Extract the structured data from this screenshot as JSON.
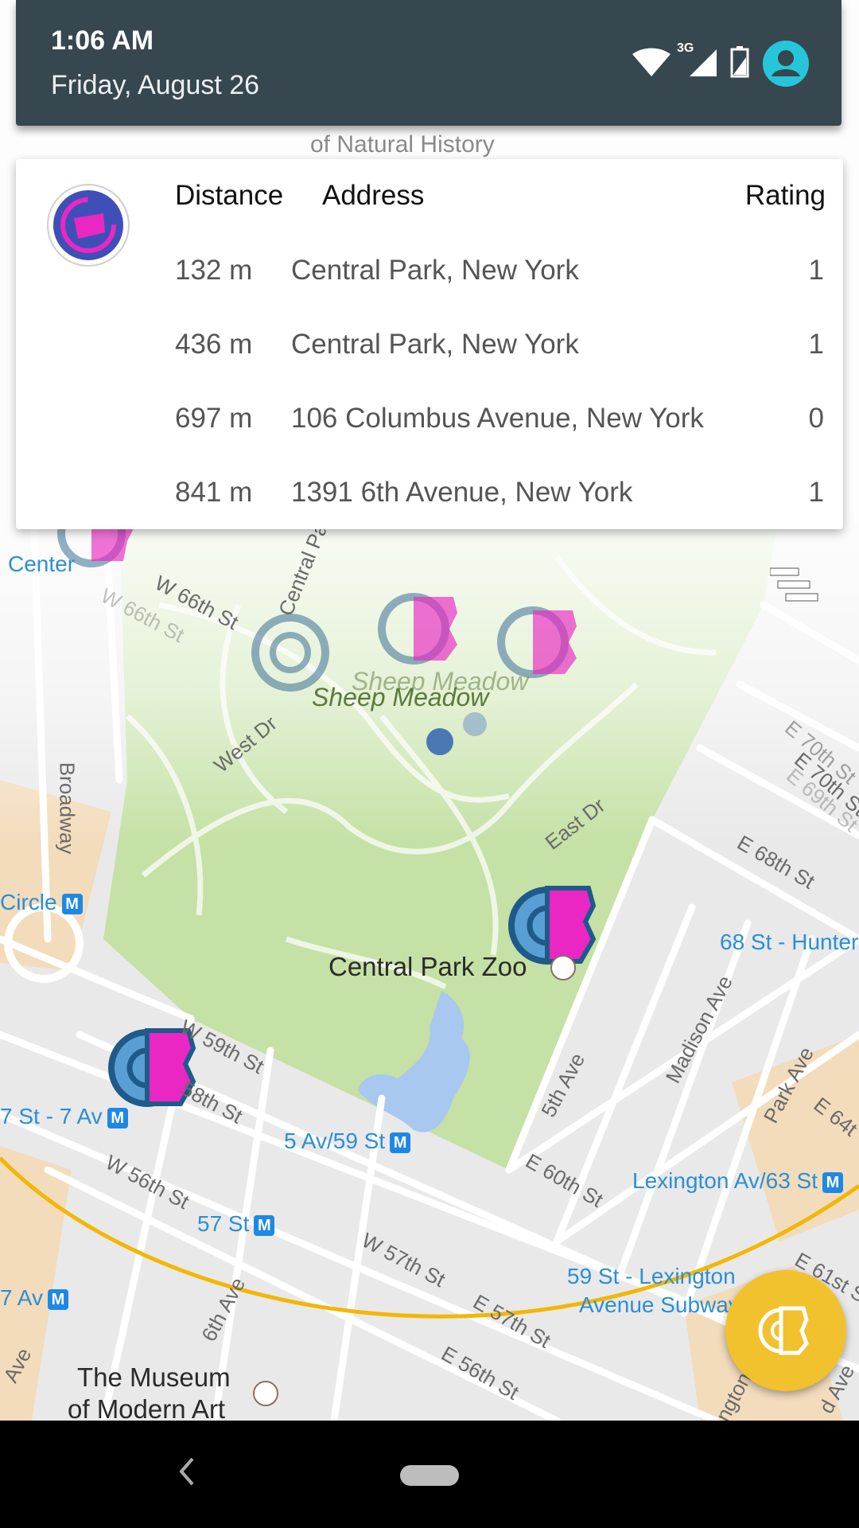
{
  "status_bar": {
    "time": "1:06 AM",
    "date": "Friday, August 26",
    "network_type": "3G",
    "icons": [
      "wifi-icon",
      "cell-signal-icon",
      "battery-icon",
      "account-icon"
    ],
    "account_color": "#26c6da"
  },
  "popup": {
    "icon": "team-gym-icon",
    "headers": {
      "distance": "Distance",
      "address": "Address",
      "rating": "Rating"
    },
    "rows": [
      {
        "distance": "132 m",
        "address": "Central Park, New York",
        "rating": "1"
      },
      {
        "distance": "436 m",
        "address": "Central Park, New York",
        "rating": "1"
      },
      {
        "distance": "697 m",
        "address": "106 Columbus Avenue, New York",
        "rating": "0"
      },
      {
        "distance": "841 m",
        "address": "1391 6th Avenue, New York",
        "rating": "1"
      }
    ]
  },
  "map": {
    "labels": {
      "sheep_meadow_1": "Sheep Meadow",
      "sheep_meadow_2": "Sheep Meadow",
      "central_park_zoo": "Central Park Zoo",
      "museum_line1": "The Museum",
      "museum_line2": "of Modern Art",
      "center": "Center",
      "circle": "Circle",
      "broadway": "Broadway",
      "w66": "W 66th St",
      "w66b": "W 66th St",
      "central_park_w": "Central Pa",
      "west_dr": "West Dr",
      "east_dr": "East Dr",
      "e70": "E 70th St",
      "e70b": "E 70th St",
      "e69": "E 69th St",
      "e68": "E 68th St",
      "st68": "68 St - Hunter",
      "w59": "W 59th St",
      "w58": "58th St",
      "st7": "7 St - 7 Av",
      "av59": "5 Av/59 St",
      "fifth_ave": "5th Ave",
      "madison": "Madison Ave",
      "park_ave": "Park Ave",
      "e64": "E 64t",
      "lexington63": "Lexington Av/63 St",
      "e60": "E 60th St",
      "w56": "W 56th St",
      "st57": "57 St",
      "w57": "W 57th St",
      "e57": "E 57th St",
      "lex59_1": "59 St - Lexington",
      "lex59_2": "Avenue Subway",
      "e61": "E 61st S",
      "av7": "7 Av",
      "sixth_ave": "6th Ave",
      "e56": "E 56th St",
      "ave_left": "Ave",
      "ave_right": "d Ave",
      "lexington_r": "ngton",
      "natural_history": "of Natural History"
    },
    "metro_glyph": "M",
    "colors": {
      "park": "#c5e1a5",
      "water": "#a8c8f0",
      "road": "#ffffff",
      "gym_ring": "#1e5a8a",
      "gym_team": "#ea27c2",
      "radius_line": "#f2b705",
      "fab": "#f2c12e"
    }
  },
  "fab": {
    "icon": "team-gym-icon"
  },
  "layers_button": {
    "icon": "layers-icon"
  },
  "nav_bar": {
    "back": "back-icon",
    "home": "home-pill-icon"
  }
}
